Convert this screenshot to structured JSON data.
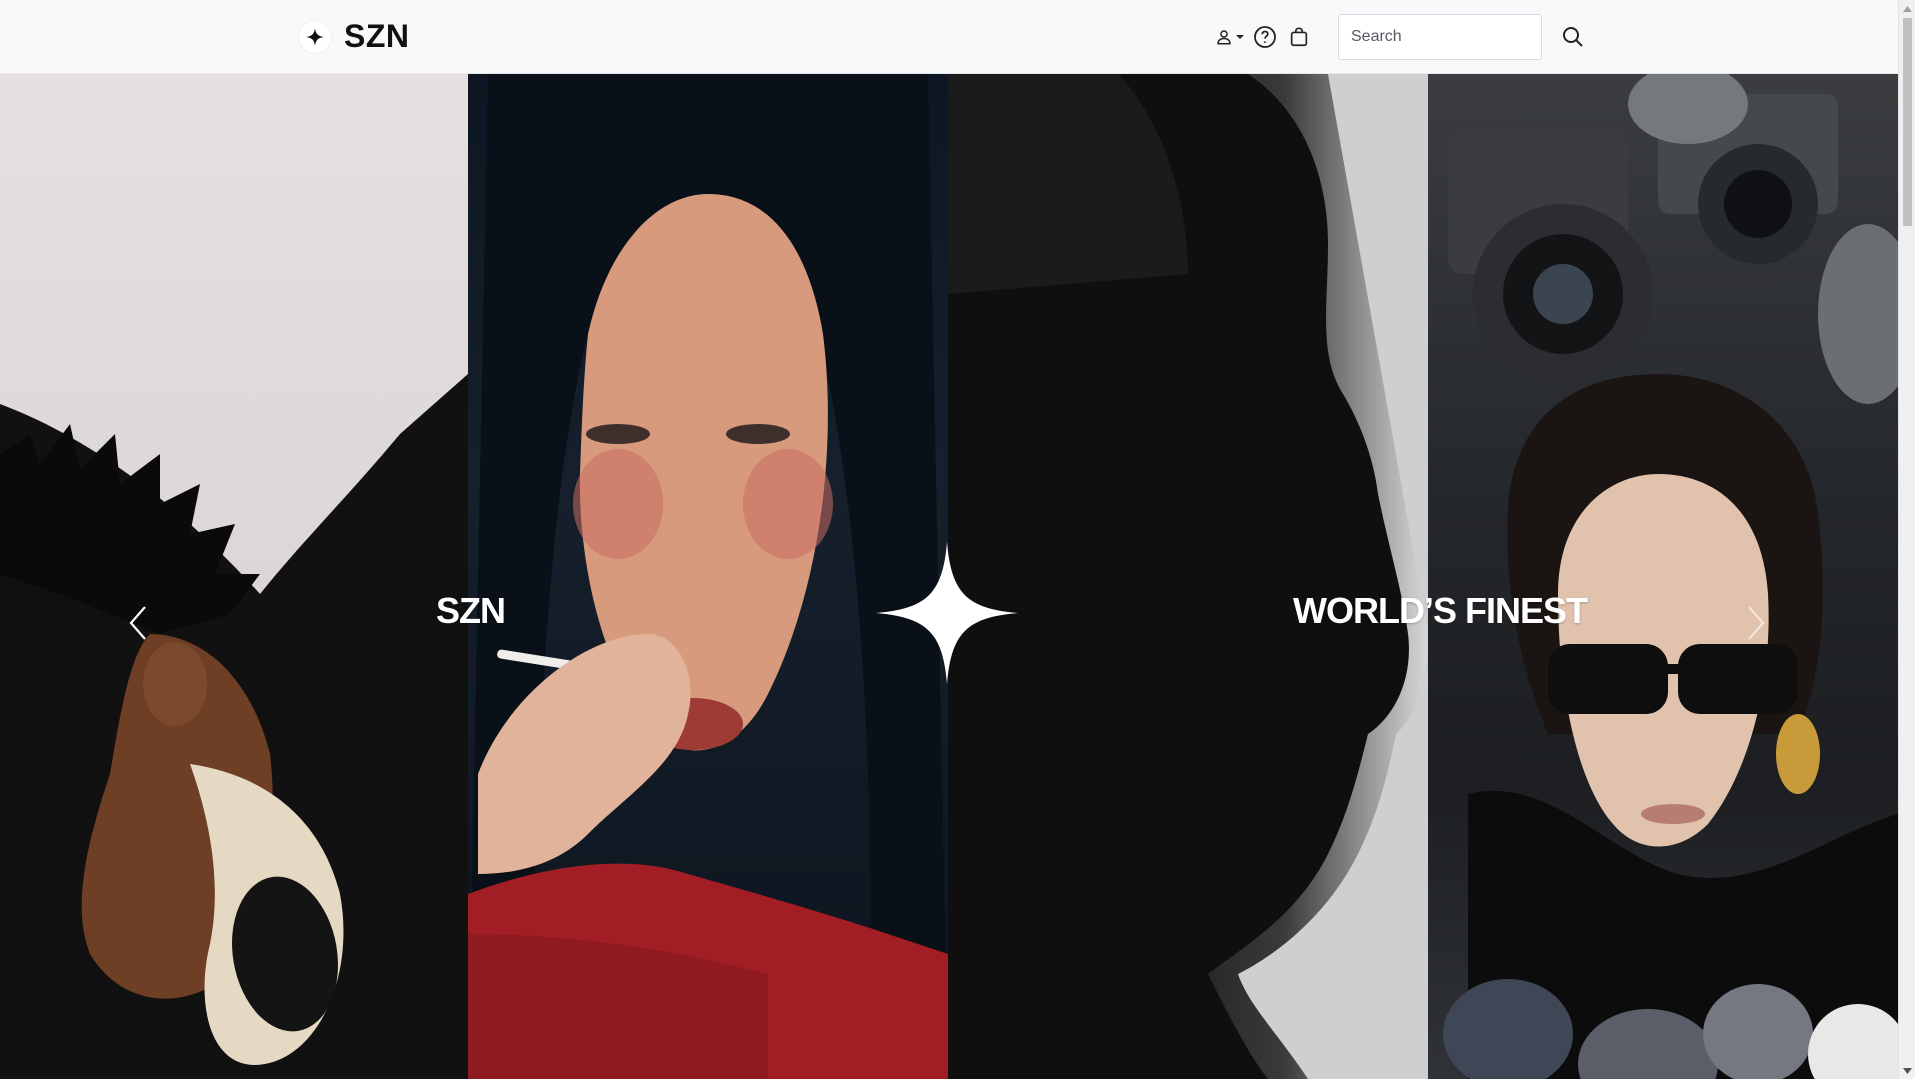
{
  "header": {
    "brand": "SZN",
    "logo_icon": "sparkle-star-icon",
    "icons": {
      "account": "user-icon",
      "account_dropdown": "caret-down-icon",
      "help": "help-circle-icon",
      "bag": "shopping-bag-icon",
      "search": "search-icon"
    },
    "search": {
      "placeholder": "Search",
      "value": ""
    }
  },
  "hero": {
    "title_left": "SZN",
    "title_right": "WORLD’S FINEST",
    "center_icon": "sparkle-star-icon",
    "prev_icon": "chevron-left-icon",
    "next_icon": "chevron-right-icon",
    "panels": [
      "photo-model-white-sunglasses",
      "photo-model-red-jacket-lollipop",
      "photo-man-profile-silhouette",
      "photo-model-black-sunglasses-cameras"
    ]
  },
  "colors": {
    "header_bg": "#f8f9fb",
    "text": "#111111",
    "hero_text": "#ffffff",
    "scrollbar_thumb": "#c1c1c1"
  }
}
